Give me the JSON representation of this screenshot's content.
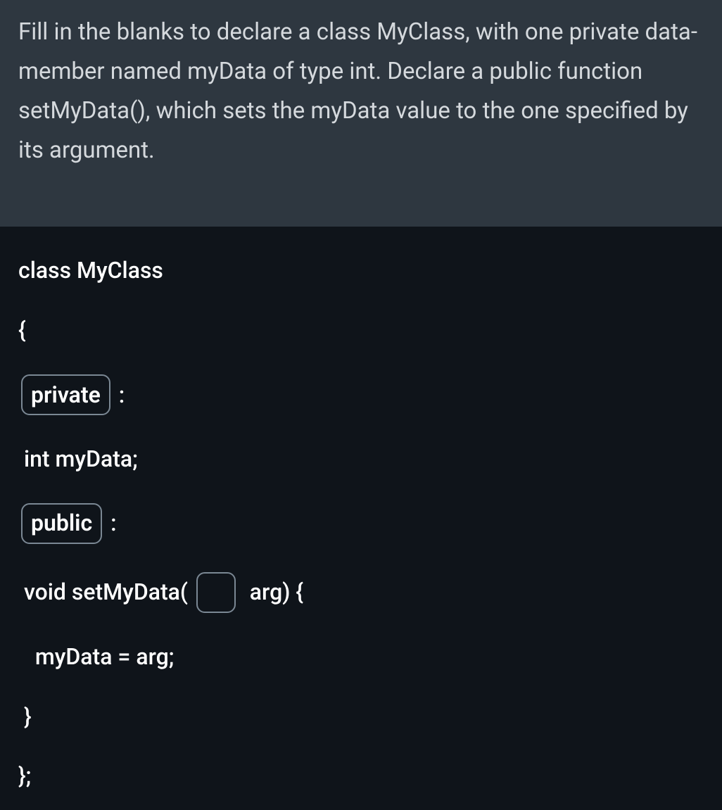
{
  "question": {
    "text": "Fill in the blanks to declare a class MyClass, with one private data-member named myData of type int. Declare a public function setMyData(), which sets the myData value to the one specified by its argument."
  },
  "code": {
    "line1": "class MyClass",
    "line2": "{",
    "blank1_value": "private",
    "after_blank1": " :",
    "line4": " int myData;",
    "blank2_value": "public",
    "after_blank2": " :",
    "line6_before": " void setMyData( ",
    "blank3_value": "",
    "line6_after": "  arg) {",
    "line7": "   myData = arg;",
    "line8": " }",
    "line9": "};"
  }
}
